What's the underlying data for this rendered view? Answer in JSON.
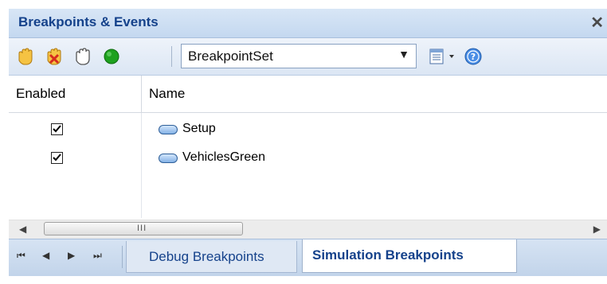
{
  "title": "Breakpoints & Events",
  "toolbar": {
    "breakpoint_set": "BreakpointSet",
    "icons": [
      "hand-icon",
      "hand-delete-icon",
      "hand-outline-icon",
      "green-dot-icon",
      "list-icon",
      "help-icon"
    ]
  },
  "columns": {
    "enabled": "Enabled",
    "name": "Name"
  },
  "rows": [
    {
      "enabled": true,
      "name": "Setup"
    },
    {
      "enabled": true,
      "name": "VehiclesGreen"
    }
  ],
  "tabs": {
    "debug": "Debug Breakpoints",
    "simulation": "Simulation Breakpoints",
    "active": "simulation"
  },
  "colors": {
    "accent": "#15428b",
    "title_bar": "#c4d8f0"
  }
}
